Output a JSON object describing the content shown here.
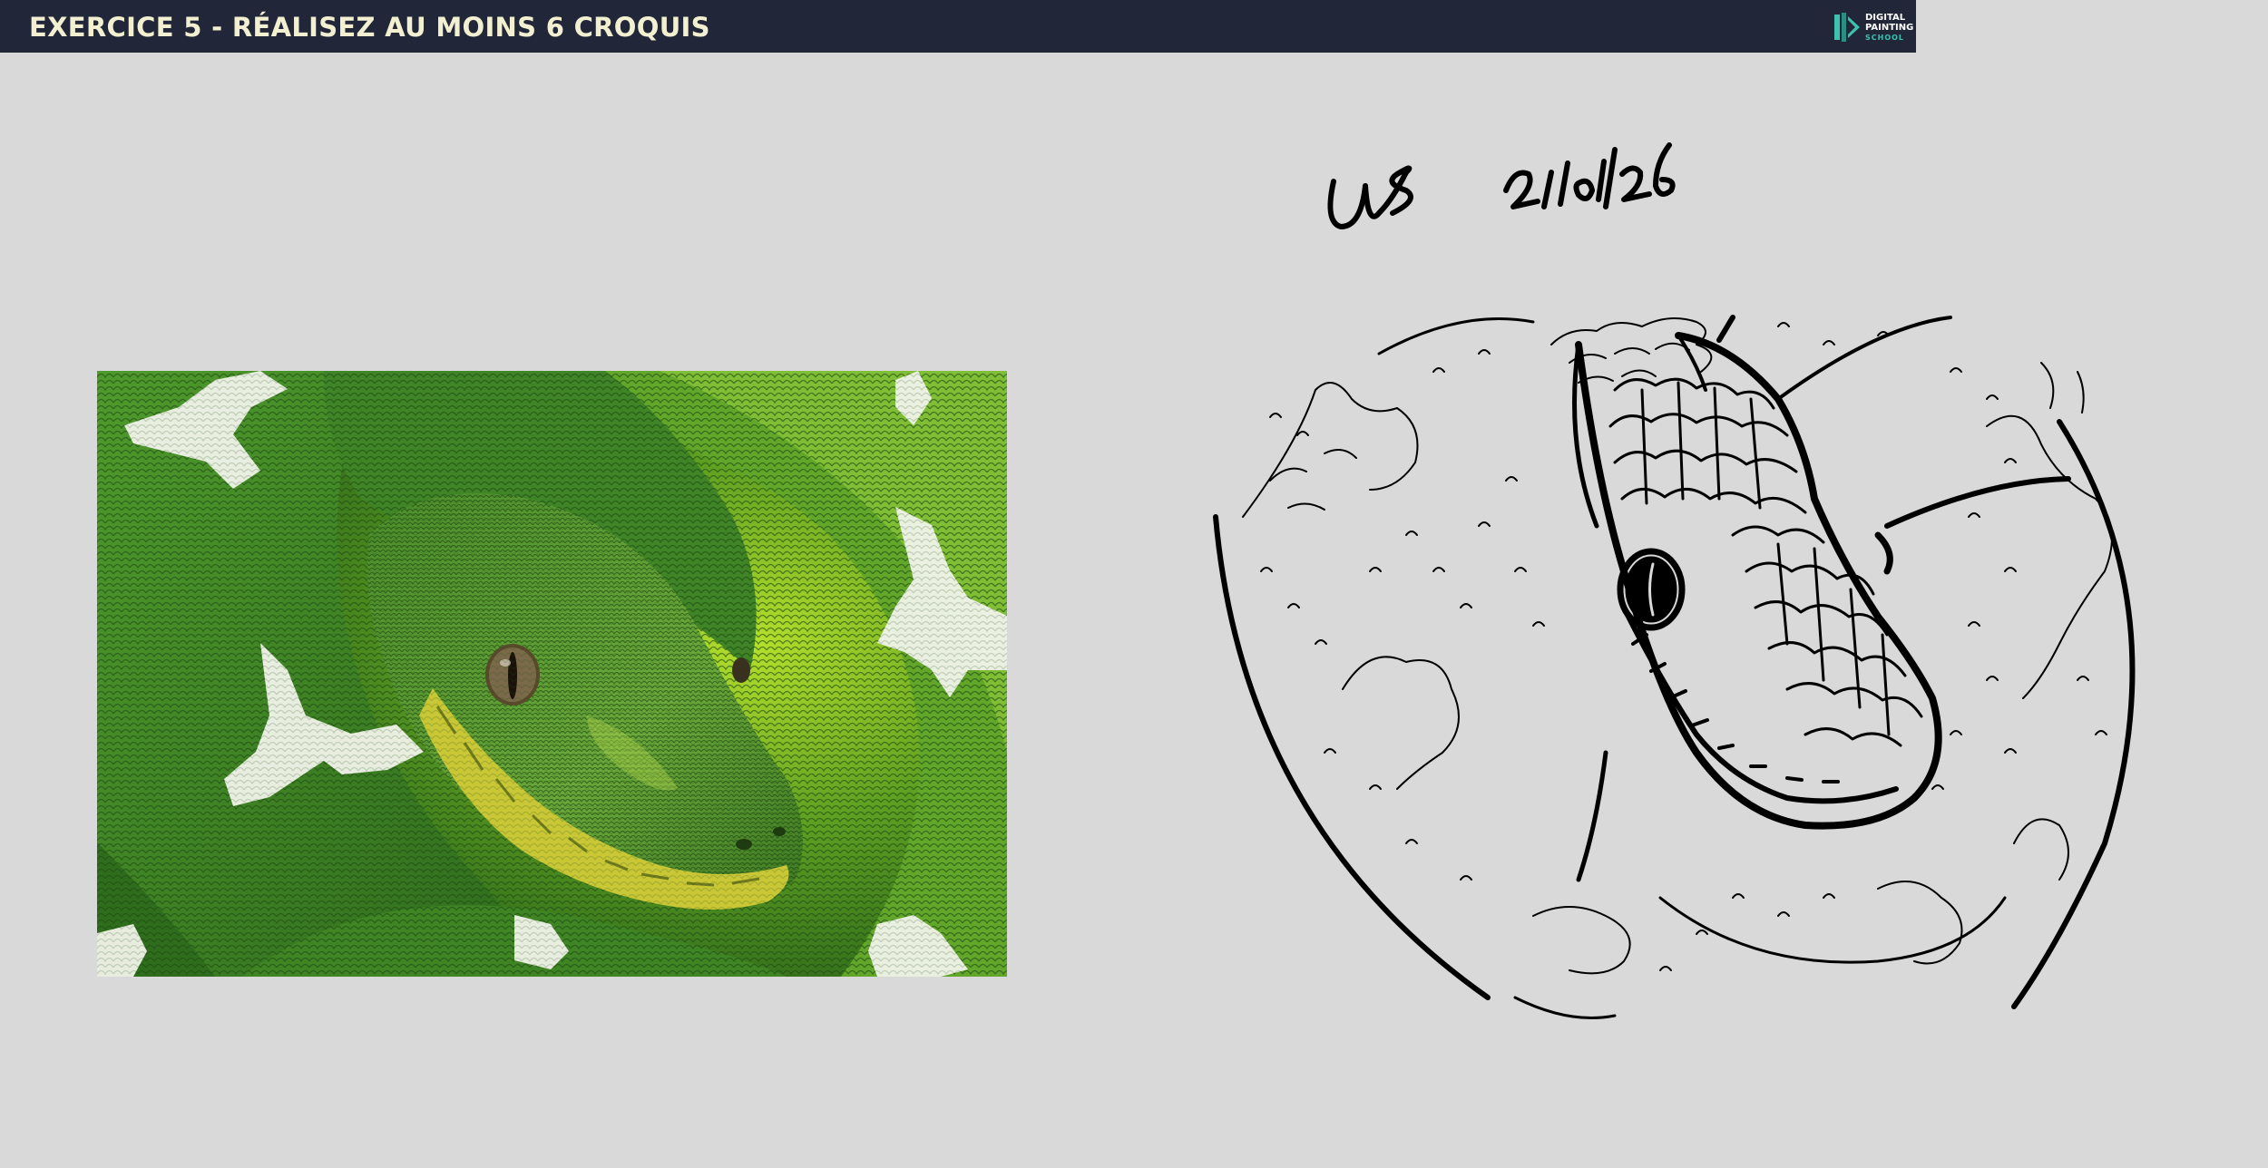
{
  "header": {
    "title": "EXERCICE 5 - RÉALISEZ AU MOINS 6 CROQUIS",
    "background": "#212738",
    "title_color": "#f3f0d2"
  },
  "logo": {
    "line1": "DIGITAL",
    "line2": "PAINTING",
    "line3": "SCHOOL",
    "icon": "brush-logo-icon",
    "accent": "#3fc1b0"
  },
  "canvas": {
    "background": "#d9d9d9"
  },
  "reference_photo": {
    "subject": "green-tree-python-photo"
  },
  "sketch": {
    "subject": "snake-line-drawing",
    "signature": "UB 21/01/26"
  }
}
